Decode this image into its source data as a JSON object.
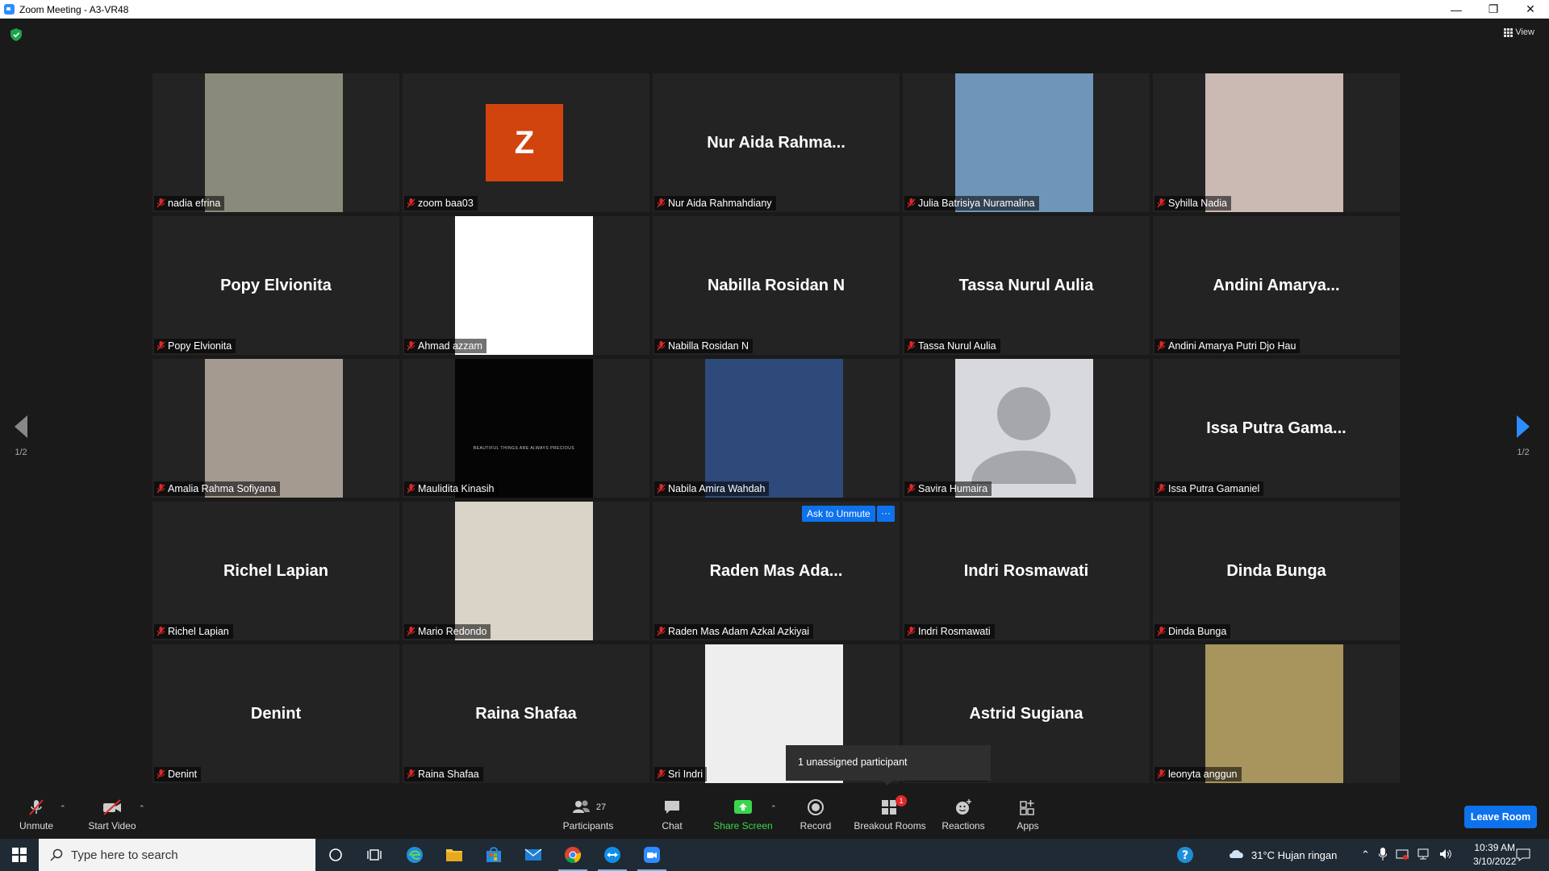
{
  "window": {
    "title": "Zoom Meeting - A3-VR48",
    "minimize": "—",
    "restore": "❐",
    "close": "✕"
  },
  "topbar": {
    "view_label": "View"
  },
  "participants": [
    {
      "big": "",
      "tag": "nadia efrina",
      "kind": "photo",
      "color": "#8a8a7a"
    },
    {
      "big": "",
      "tag": "zoom baa03",
      "kind": "avatar",
      "initial": "Z"
    },
    {
      "big": "Nur Aida Rahma...",
      "tag": "Nur Aida Rahmahdiany",
      "kind": "name"
    },
    {
      "big": "",
      "tag": "Julia Batrisiya Nuramalina",
      "kind": "photo",
      "color": "#6f95b8"
    },
    {
      "big": "",
      "tag": "Syhilla Nadia",
      "kind": "photo",
      "color": "#cbb9b4"
    },
    {
      "big": "Popy Elvionita",
      "tag": "Popy Elvionita",
      "kind": "name"
    },
    {
      "big": "",
      "tag": "Ahmad azzam",
      "kind": "photo",
      "color": "#ffffff"
    },
    {
      "big": "Nabilla Rosidan N",
      "tag": "Nabilla Rosidan N",
      "kind": "name"
    },
    {
      "big": "Tassa Nurul Aulia",
      "tag": "Tassa Nurul Aulia",
      "kind": "name"
    },
    {
      "big": "Andini  Amarya...",
      "tag": "Andini Amarya Putri Djo Hau",
      "kind": "name"
    },
    {
      "big": "",
      "tag": "Amalia Rahma Sofiyana",
      "kind": "photo",
      "color": "#a49a90"
    },
    {
      "big": "",
      "tag": "Maulidita Kinasih",
      "kind": "photo",
      "color": "#050505",
      "caption": "BEAUTIFUL THINGS ARE ALWAYS PRECIOUS"
    },
    {
      "big": "",
      "tag": "Nabila Amira Wahdah",
      "kind": "photo",
      "color": "#2e4a7a"
    },
    {
      "big": "",
      "tag": "Savira Humaira",
      "kind": "person"
    },
    {
      "big": "Issa Putra Gama...",
      "tag": "Issa Putra Gamaniel",
      "kind": "name"
    },
    {
      "big": "Richel Lapian",
      "tag": "Richel Lapian",
      "kind": "name"
    },
    {
      "big": "",
      "tag": "Mario Redondo",
      "kind": "photo",
      "color": "#d9d3c8"
    },
    {
      "big": "Raden Mas Ada...",
      "tag": "Raden Mas Adam Azkal Azkiyai",
      "kind": "name"
    },
    {
      "big": "Indri Rosmawati",
      "tag": "Indri Rosmawati",
      "kind": "name"
    },
    {
      "big": "Dinda Bunga",
      "tag": "Dinda Bunga",
      "kind": "name"
    },
    {
      "big": "Denint",
      "tag": "Denint",
      "kind": "name"
    },
    {
      "big": "Raina Shafaa",
      "tag": "Raina Shafaa",
      "kind": "name"
    },
    {
      "big": "",
      "tag": "Sri Indri",
      "kind": "photo",
      "color": "#eeeeee"
    },
    {
      "big": "Astrid Sugiana",
      "tag": "Astrid Sugiana",
      "kind": "name"
    },
    {
      "big": "",
      "tag": "leonyta anggun",
      "kind": "photo",
      "color": "#a8955e"
    }
  ],
  "pager": {
    "left": "1/2",
    "right": "1/2"
  },
  "popups": {
    "ask_unmute": "Ask to Unmute",
    "more": "···",
    "unassigned": "1 unassigned participant"
  },
  "toolbar": {
    "unmute": "Unmute",
    "start_video": "Start Video",
    "participants": "Participants",
    "participants_count": "27",
    "chat": "Chat",
    "share_screen": "Share Screen",
    "record": "Record",
    "breakout_rooms": "Breakout Rooms",
    "breakout_badge": "1",
    "reactions": "Reactions",
    "apps": "Apps",
    "leave": "Leave Room"
  },
  "taskbar": {
    "search_placeholder": "Type here to search",
    "weather": "31°C  Hujan ringan",
    "time": "10:39 AM",
    "date": "3/10/2022"
  },
  "colors": {
    "accent": "#0e72ed",
    "green": "#3ad64d",
    "mute_red": "#e02828"
  }
}
